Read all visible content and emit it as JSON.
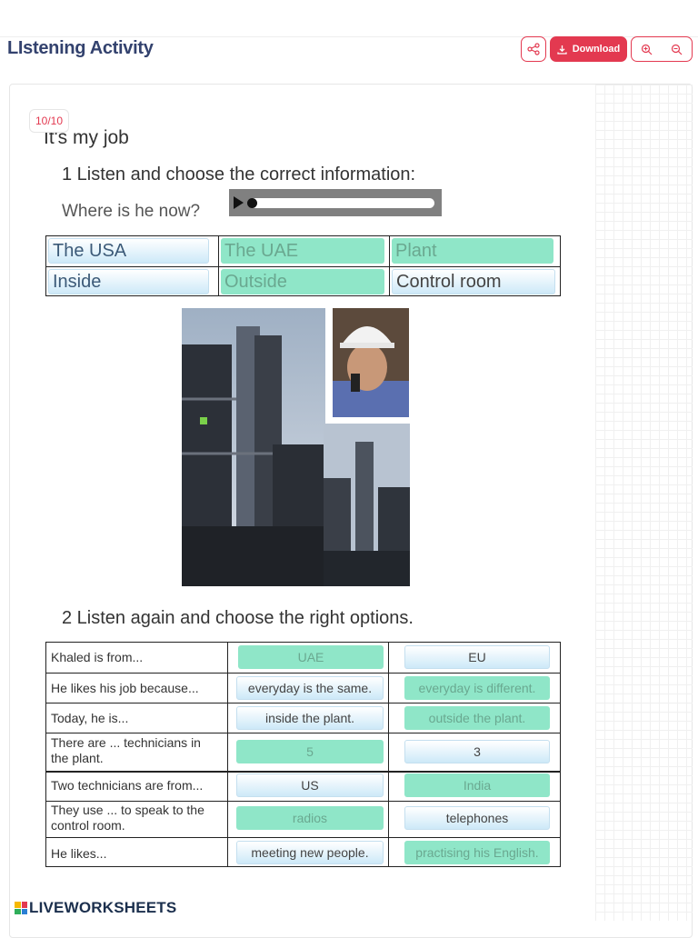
{
  "header": {
    "title": "LIstening Activity",
    "download_label": "Download"
  },
  "counter": "10/10",
  "worksheet": {
    "subtitle": "It's my job",
    "task1_title": "1  Listen and choose the correct information:",
    "question": "Where is he now?",
    "options_row1": [
      "The USA",
      "The UAE",
      "Plant"
    ],
    "options_row2": [
      "Inside",
      "Outside",
      "Control room"
    ],
    "task2_title": "2  Listen again and choose the right options.",
    "rows": [
      {
        "q": "Khaled is from...",
        "a": "UAE",
        "b": "EU"
      },
      {
        "q": "He likes his job because...",
        "a": "everyday is the same.",
        "b": "everyday is different."
      },
      {
        "q": "Today, he is...",
        "a": "inside the plant.",
        "b": "outside the plant."
      },
      {
        "q": "There are ... technicians in the plant.",
        "a": "5",
        "b": "3"
      },
      {
        "q": "Two technicians are from...",
        "a": "US",
        "b": "India"
      },
      {
        "q": "They use  ... to speak to the control room.",
        "a": "radios",
        "b": "telephones"
      },
      {
        "q": "He likes...",
        "a": "meeting new people.",
        "b": "practising his English."
      }
    ]
  },
  "footer": {
    "brand": "LIVEWORKSHEETS"
  },
  "colors": {
    "accent": "#e33950",
    "title": "#33426e",
    "selected": "#8fe6c8",
    "option": "#cde9f8"
  },
  "icons": [
    "share-icon",
    "download-icon",
    "zoom-in-icon",
    "zoom-out-icon",
    "play-icon"
  ]
}
